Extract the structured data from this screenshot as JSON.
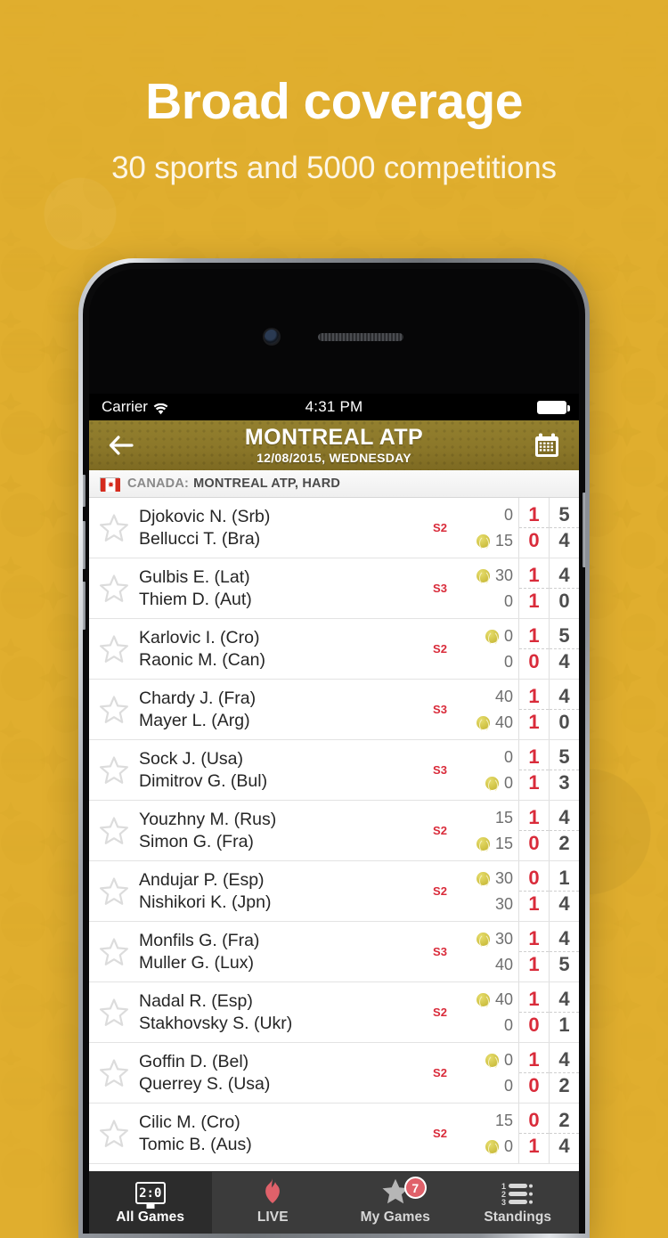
{
  "promo": {
    "headline": "Broad coverage",
    "subheadline": "30 sports and 5000 competitions"
  },
  "colors": {
    "background_gold": "#e0ae2e",
    "titlebar_olive": "#8b7729",
    "accent_red": "#d92b3a",
    "tabbar_dark": "#3b3b3b",
    "tab_active_dark": "#2c2c2c",
    "ball_yellow": "#cdbf3f"
  },
  "statusbar": {
    "carrier": "Carrier",
    "wifi_icon": "wifi-icon",
    "time": "4:31 PM",
    "battery_icon": "battery-full-icon"
  },
  "header": {
    "back_icon": "back-arrow-icon",
    "title": "MONTREAL ATP",
    "date": "12/08/2015, WEDNESDAY",
    "calendar_icon": "calendar-icon"
  },
  "league": {
    "flag_icon": "canada-flag-icon",
    "country": "CANADA:",
    "name": "MONTREAL ATP, HARD"
  },
  "matches": [
    {
      "favorite_icon": "star-outline-icon",
      "set": "S2",
      "players": [
        {
          "name": "Djokovic N. (Srb)",
          "points": "0",
          "serving": false,
          "sets": "1",
          "games": "5"
        },
        {
          "name": "Bellucci T. (Bra)",
          "points": "15",
          "serving": true,
          "sets": "0",
          "games": "4"
        }
      ]
    },
    {
      "favorite_icon": "star-outline-icon",
      "set": "S3",
      "players": [
        {
          "name": "Gulbis E. (Lat)",
          "points": "30",
          "serving": true,
          "sets": "1",
          "games": "4"
        },
        {
          "name": "Thiem D. (Aut)",
          "points": "0",
          "serving": false,
          "sets": "1",
          "games": "0"
        }
      ]
    },
    {
      "favorite_icon": "star-outline-icon",
      "set": "S2",
      "players": [
        {
          "name": "Karlovic I. (Cro)",
          "points": "0",
          "serving": true,
          "sets": "1",
          "games": "5"
        },
        {
          "name": "Raonic M. (Can)",
          "points": "0",
          "serving": false,
          "sets": "0",
          "games": "4"
        }
      ]
    },
    {
      "favorite_icon": "star-outline-icon",
      "set": "S3",
      "players": [
        {
          "name": "Chardy J. (Fra)",
          "points": "40",
          "serving": false,
          "sets": "1",
          "games": "4"
        },
        {
          "name": "Mayer L. (Arg)",
          "points": "40",
          "serving": true,
          "sets": "1",
          "games": "0"
        }
      ]
    },
    {
      "favorite_icon": "star-outline-icon",
      "set": "S3",
      "players": [
        {
          "name": "Sock J. (Usa)",
          "points": "0",
          "serving": false,
          "sets": "1",
          "games": "5"
        },
        {
          "name": "Dimitrov G. (Bul)",
          "points": "0",
          "serving": true,
          "sets": "1",
          "games": "3"
        }
      ]
    },
    {
      "favorite_icon": "star-outline-icon",
      "set": "S2",
      "players": [
        {
          "name": "Youzhny M. (Rus)",
          "points": "15",
          "serving": false,
          "sets": "1",
          "games": "4"
        },
        {
          "name": "Simon G. (Fra)",
          "points": "15",
          "serving": true,
          "sets": "0",
          "games": "2"
        }
      ]
    },
    {
      "favorite_icon": "star-outline-icon",
      "set": "S2",
      "players": [
        {
          "name": "Andujar P. (Esp)",
          "points": "30",
          "serving": true,
          "sets": "0",
          "games": "1"
        },
        {
          "name": "Nishikori K. (Jpn)",
          "points": "30",
          "serving": false,
          "sets": "1",
          "games": "4"
        }
      ]
    },
    {
      "favorite_icon": "star-outline-icon",
      "set": "S3",
      "players": [
        {
          "name": "Monfils G. (Fra)",
          "points": "30",
          "serving": true,
          "sets": "1",
          "games": "4"
        },
        {
          "name": "Muller G. (Lux)",
          "points": "40",
          "serving": false,
          "sets": "1",
          "games": "5"
        }
      ]
    },
    {
      "favorite_icon": "star-outline-icon",
      "set": "S2",
      "players": [
        {
          "name": "Nadal R. (Esp)",
          "points": "40",
          "serving": true,
          "sets": "1",
          "games": "4"
        },
        {
          "name": "Stakhovsky S. (Ukr)",
          "points": "0",
          "serving": false,
          "sets": "0",
          "games": "1"
        }
      ]
    },
    {
      "favorite_icon": "star-outline-icon",
      "set": "S2",
      "players": [
        {
          "name": "Goffin D. (Bel)",
          "points": "0",
          "serving": true,
          "sets": "1",
          "games": "4"
        },
        {
          "name": "Querrey S. (Usa)",
          "points": "0",
          "serving": false,
          "sets": "0",
          "games": "2"
        }
      ]
    },
    {
      "favorite_icon": "star-outline-icon",
      "set": "S2",
      "players": [
        {
          "name": "Cilic M. (Cro)",
          "points": "15",
          "serving": false,
          "sets": "0",
          "games": "2"
        },
        {
          "name": "Tomic B. (Aus)",
          "points": "0",
          "serving": true,
          "sets": "1",
          "games": "4"
        }
      ]
    }
  ],
  "tabs": [
    {
      "label": "All Games",
      "icon": "scoreboard-icon",
      "icon_text": "2:0",
      "active": true,
      "badge": null
    },
    {
      "label": "LIVE",
      "icon": "flame-icon",
      "active": false,
      "badge": null
    },
    {
      "label": "My Games",
      "icon": "star-icon",
      "active": false,
      "badge": "7"
    },
    {
      "label": "Standings",
      "icon": "standings-list-icon",
      "active": false,
      "badge": null,
      "rows": [
        "1",
        "2",
        "3"
      ]
    }
  ]
}
